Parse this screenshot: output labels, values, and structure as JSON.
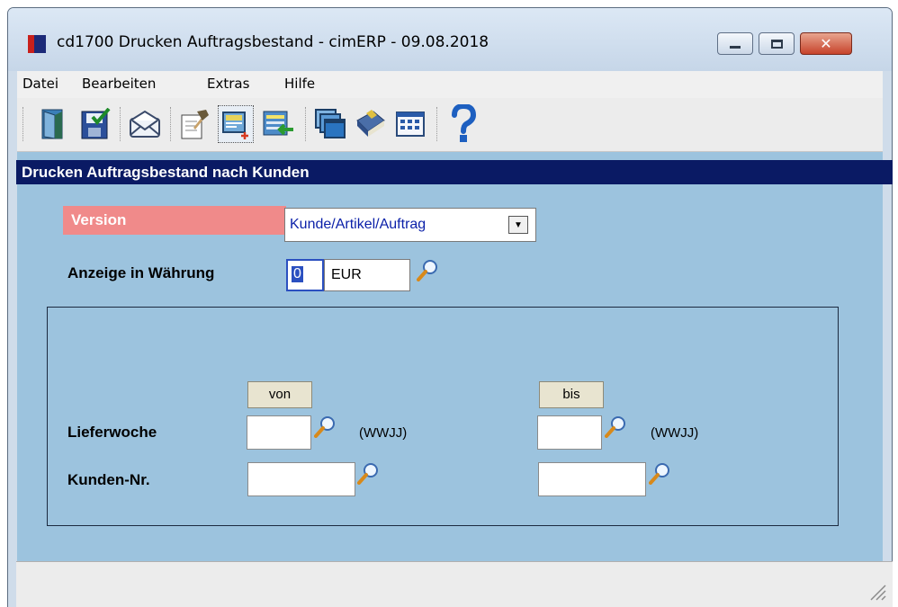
{
  "window": {
    "title": "cd1700 Drucken Auftragsbestand - cimERP - 09.08.2018",
    "controls": [
      "minimize",
      "maximize",
      "close"
    ]
  },
  "menu": {
    "items": [
      {
        "label": "Datei"
      },
      {
        "label": "Bearbeiten"
      },
      {
        "label": "Extras"
      },
      {
        "label": "Hilfe"
      }
    ]
  },
  "toolbar": {
    "buttons": [
      {
        "icon": "exit-door-icon"
      },
      {
        "icon": "save-icon"
      },
      {
        "icon": "mail-icon"
      },
      {
        "icon": "edit-form-icon"
      },
      {
        "icon": "new-record-icon"
      },
      {
        "icon": "list-import-icon"
      },
      {
        "icon": "windows-icon"
      },
      {
        "icon": "book-icon"
      },
      {
        "icon": "calendar-grid-icon"
      },
      {
        "icon": "help-icon"
      }
    ]
  },
  "form": {
    "header": "Drucken Auftragsbestand nach Kunden",
    "version": {
      "label": "Version",
      "selected": "Kunde/Artikel/Auftrag"
    },
    "currency": {
      "label": "Anzeige in Währung",
      "code": "0",
      "name": "EUR"
    },
    "range": {
      "from_label": "von",
      "to_label": "bis",
      "rows": [
        {
          "label": "Lieferwoche",
          "from": "",
          "to": "",
          "hint": "(WWJJ)"
        },
        {
          "label": "Kunden-Nr.",
          "from": "",
          "to": "",
          "hint": ""
        }
      ]
    }
  },
  "status": {
    "text": ""
  },
  "colors": {
    "header_bg": "#0a1a64",
    "form_bg": "#9cc3de",
    "required_label_bg": "#f08a8a"
  }
}
